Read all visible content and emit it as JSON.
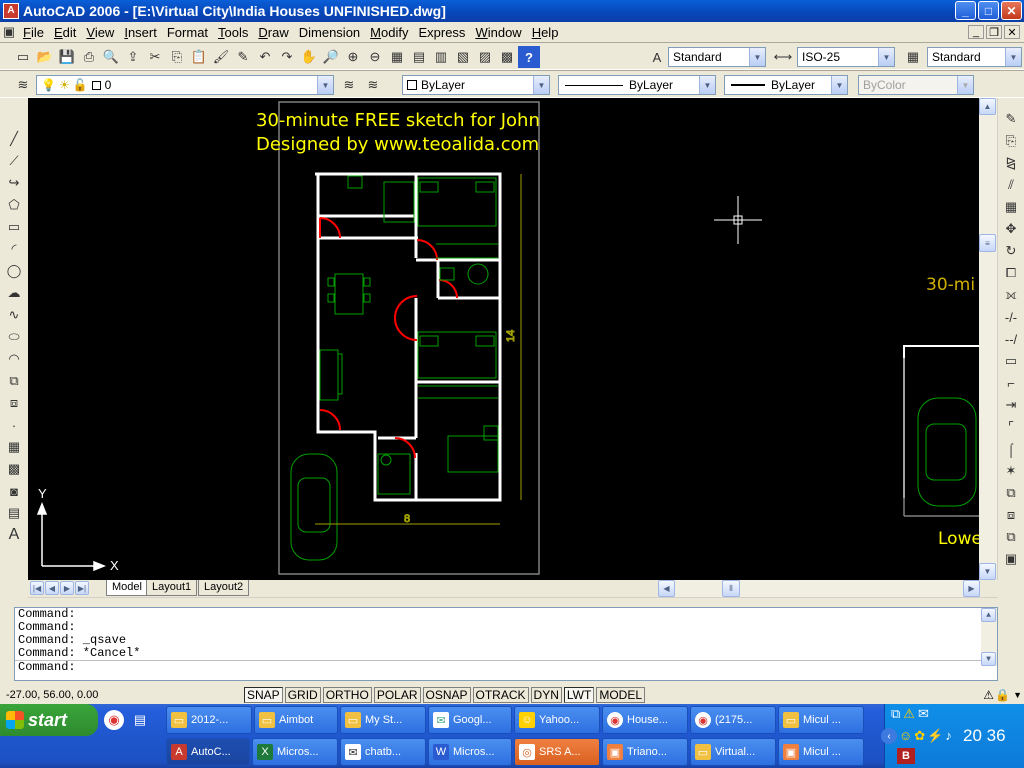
{
  "window": {
    "title": "AutoCAD 2006 - [E:\\Virtual City\\India Houses UNFINISHED.dwg]",
    "min": "_",
    "max": "□",
    "close": "✕"
  },
  "menu": [
    {
      "u": "F",
      "rest": "ile"
    },
    {
      "u": "E",
      "rest": "dit"
    },
    {
      "u": "V",
      "rest": "iew"
    },
    {
      "u": "I",
      "rest": "nsert"
    },
    {
      "u": "",
      "rest": "Format"
    },
    {
      "u": "T",
      "rest": "ools"
    },
    {
      "u": "D",
      "rest": "raw"
    },
    {
      "u": "",
      "rest": "Dimension"
    },
    {
      "u": "M",
      "rest": "odify"
    },
    {
      "u": "",
      "rest": "Express"
    },
    {
      "u": "W",
      "rest": "indow"
    },
    {
      "u": "H",
      "rest": "elp"
    }
  ],
  "styles": {
    "text_style": "Standard",
    "dim_style": "ISO-25",
    "table_style": "Standard"
  },
  "layers": {
    "current": "0",
    "color": "ByLayer",
    "linetype": "ByLayer",
    "lineweight": "ByLayer",
    "plotstyle": "ByColor"
  },
  "drawing": {
    "annotation_line1": "30-minute FREE sketch for John",
    "annotation_line2": "Designed by www.teoalida.com",
    "dim_vertical": "14",
    "dim_horizontal": "8",
    "partial_text_right": "30-mi",
    "partial_text_lower": "Lowe",
    "ucs_x": "X",
    "ucs_y": "Y"
  },
  "layout_tabs": {
    "model": "Model",
    "layout1": "Layout1",
    "layout2": "Layout2"
  },
  "command_lines": [
    "Command:",
    "Command:",
    "Command: _qsave",
    "Command: *Cancel*",
    "Command:"
  ],
  "status": {
    "coords": "-27.00, 56.00, 0.00",
    "buttons": [
      "SNAP",
      "GRID",
      "ORTHO",
      "POLAR",
      "OSNAP",
      "OTRACK",
      "DYN",
      "LWT",
      "MODEL"
    ]
  },
  "taskbar": {
    "start": "start",
    "clock": "20 36",
    "row1": [
      "2012-...",
      "Aimbot",
      "My St...",
      "Googl...",
      "Yahoo...",
      "House...",
      "(2175...",
      "Micul ..."
    ],
    "row2": [
      "AutoC...",
      "Micros...",
      "chatb...",
      "Micros...",
      "SRS A...",
      "Triano...",
      "Virtual...",
      "Micul ..."
    ]
  },
  "colors": {
    "annotation": "#ffff00",
    "walls": "#ffffff",
    "furniture": "#00a000",
    "doors": "#ff0000",
    "dimension": "#a0a000"
  }
}
